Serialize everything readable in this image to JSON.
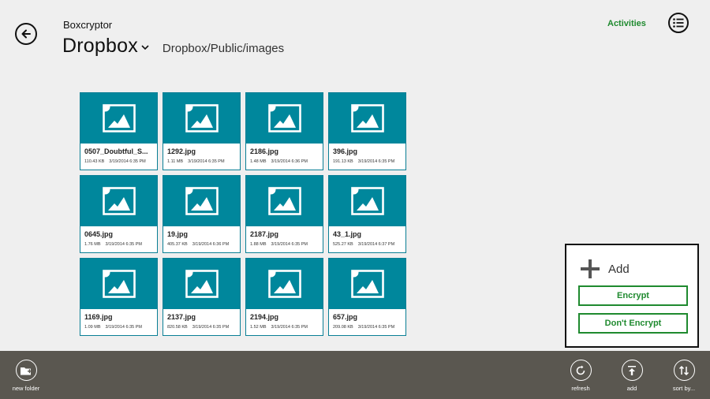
{
  "header": {
    "app_name": "Boxcryptor",
    "location_title": "Dropbox",
    "path": "Dropbox/Public/images",
    "activities_label": "Activities"
  },
  "files": [
    {
      "name": "0507_Doubtful_S...",
      "size": "110.43 KB",
      "date": "3/19/2014 6:35 PM"
    },
    {
      "name": "1292.jpg",
      "size": "1.11 MB",
      "date": "3/19/2014 6:35 PM"
    },
    {
      "name": "2186.jpg",
      "size": "1.48 MB",
      "date": "3/19/2014 6:36 PM"
    },
    {
      "name": "396.jpg",
      "size": "191.13 KB",
      "date": "3/19/2014 6:35 PM"
    },
    {
      "name": "0645.jpg",
      "size": "1.76 MB",
      "date": "3/19/2014 6:35 PM"
    },
    {
      "name": "19.jpg",
      "size": "405.37 KB",
      "date": "3/19/2014 6:36 PM"
    },
    {
      "name": "2187.jpg",
      "size": "1.88 MB",
      "date": "3/19/2014 6:35 PM"
    },
    {
      "name": "43_1.jpg",
      "size": "525.27 KB",
      "date": "3/19/2014 6:37 PM"
    },
    {
      "name": "1169.jpg",
      "size": "1.09 MB",
      "date": "3/19/2014 6:35 PM"
    },
    {
      "name": "2137.jpg",
      "size": "820.58 KB",
      "date": "3/19/2014 6:35 PM"
    },
    {
      "name": "2194.jpg",
      "size": "1.52 MB",
      "date": "3/19/2014 6:35 PM"
    },
    {
      "name": "657.jpg",
      "size": "209.08 KB",
      "date": "3/19/2014 6:35 PM"
    }
  ],
  "add_flyout": {
    "title": "Add",
    "encrypt_label": "Encrypt",
    "dont_encrypt_label": "Don't Encrypt"
  },
  "app_bar": {
    "new_folder_label": "new folder",
    "refresh_label": "refresh",
    "add_label": "add",
    "sort_label": "sort by..."
  },
  "colors": {
    "tile_accent": "#00879c",
    "green_accent": "#1f8a2f",
    "app_bar_bg": "#5a5750"
  },
  "icons": {
    "back": "back-arrow-icon",
    "menu": "list-menu-icon",
    "thumbnail": "image-placeholder-icon",
    "add": "plus-icon",
    "new_folder": "new-folder-icon",
    "refresh": "refresh-icon",
    "upload": "upload-icon",
    "sort": "sort-icon"
  }
}
